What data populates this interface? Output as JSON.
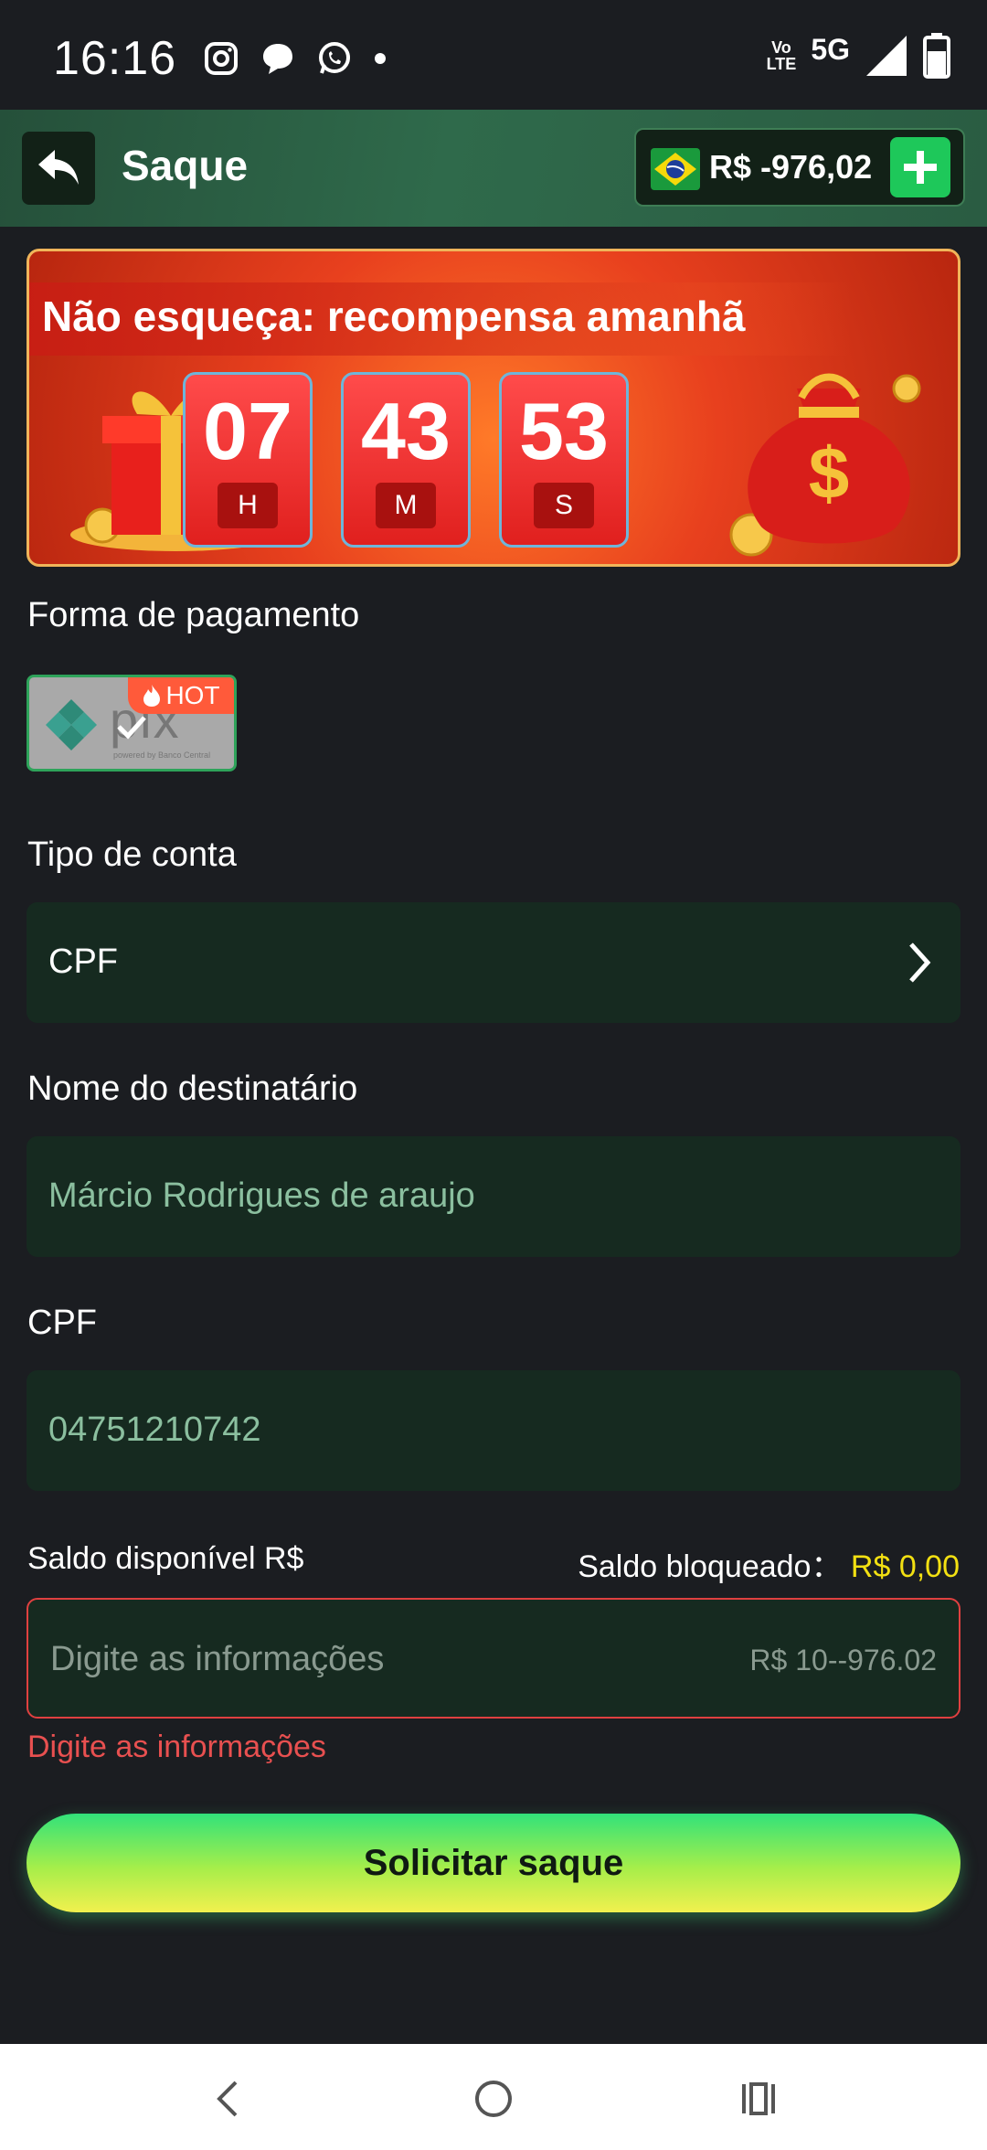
{
  "status_bar": {
    "time": "16:16",
    "volte_top": "Vo",
    "volte_bottom": "LTE",
    "network": "5G"
  },
  "header": {
    "title": "Saque",
    "balance": "R$ -976,02",
    "back_icon": "back-arrow-icon",
    "add_icon": "plus-icon"
  },
  "banner": {
    "title": "Não esqueça: recompensa amanhã",
    "timer": {
      "hours": "07",
      "hours_label": "H",
      "minutes": "43",
      "minutes_label": "M",
      "seconds": "53",
      "seconds_label": "S"
    }
  },
  "payment": {
    "label": "Forma de pagamento",
    "method_name": "pix",
    "method_subtitle": "powered by Banco Central",
    "hot_badge": "HOT"
  },
  "account_type": {
    "label": "Tipo de conta",
    "value": "CPF"
  },
  "recipient": {
    "label": "Nome do destinatário",
    "value": "Márcio Rodrigues de araujo"
  },
  "cpf": {
    "label": "CPF",
    "value": "04751210742"
  },
  "balance_info": {
    "available_label": "Saldo disponível R$",
    "blocked_label": "Saldo bloqueado：",
    "blocked_value": "R$ 0,00"
  },
  "amount": {
    "placeholder": "Digite as informações",
    "range": "R$ 10--976.02",
    "error": "Digite as informações"
  },
  "submit": {
    "label": "Solicitar saque"
  },
  "colors": {
    "background": "#1b1d21",
    "field_bg": "#162a20",
    "accent_green": "#1ec85a",
    "error_red": "#e04040",
    "blocked_yellow": "#f2e012"
  }
}
